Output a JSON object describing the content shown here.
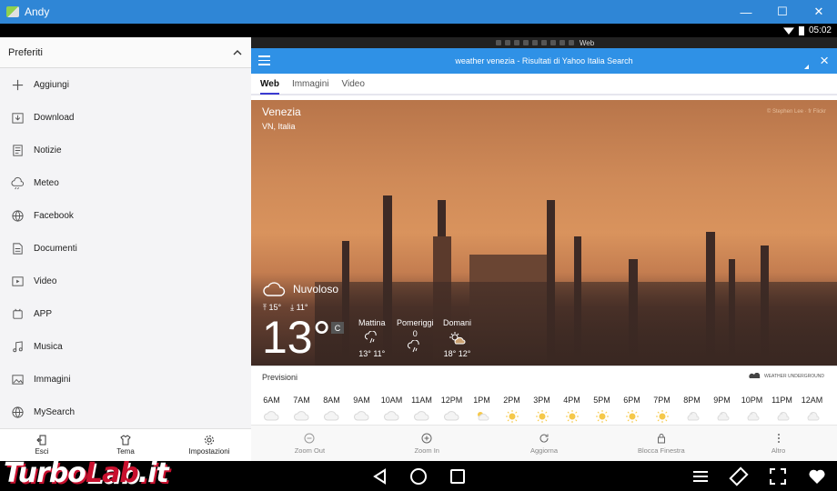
{
  "window": {
    "title": "Andy",
    "controls": [
      "—",
      "☐",
      "✕"
    ]
  },
  "status_bar": {
    "time": "05:02"
  },
  "sidebar": {
    "header": "Preferiti",
    "items": [
      {
        "label": "Aggiungi",
        "icon": "plus-icon"
      },
      {
        "label": "Download",
        "icon": "download-icon"
      },
      {
        "label": "Notizie",
        "icon": "news-icon"
      },
      {
        "label": "Meteo",
        "icon": "weather-icon"
      },
      {
        "label": "Facebook",
        "icon": "globe-icon"
      },
      {
        "label": "Documenti",
        "icon": "document-icon"
      },
      {
        "label": "Video",
        "icon": "video-icon"
      },
      {
        "label": "APP",
        "icon": "app-icon"
      },
      {
        "label": "Musica",
        "icon": "music-icon"
      },
      {
        "label": "Immagini",
        "icon": "image-icon"
      },
      {
        "label": "MySearch",
        "icon": "globe-icon"
      }
    ],
    "bottom": [
      {
        "label": "Esci",
        "icon": "exit-icon"
      },
      {
        "label": "Tema",
        "icon": "shirt-icon"
      },
      {
        "label": "Impostazioni",
        "icon": "gear-icon"
      }
    ]
  },
  "browser": {
    "favbar_label": "Web",
    "page_title": "weather venezia - Risultati di Yahoo Italia Search",
    "tabs": [
      {
        "label": "Web",
        "active": true
      },
      {
        "label": "Immagini",
        "active": false
      },
      {
        "label": "Video",
        "active": false
      }
    ],
    "weather": {
      "city": "Venezia",
      "region": "VN, Italia",
      "credit": "© Stephen Lee · fr Flickr",
      "condition": "Nuvoloso",
      "high": "15°",
      "low": "11°",
      "temperature": "13°",
      "unit": "C",
      "forecast": [
        {
          "label": "Mattina",
          "values": "13°  11°",
          "icon": "rain-icon"
        },
        {
          "label": "Pomeriggi",
          "values": "0",
          "icon": "rain-icon"
        },
        {
          "label": "Domani",
          "values": "18°  12°",
          "icon": "partly-sunny-icon"
        }
      ]
    },
    "previsioni": {
      "title": "Previsioni",
      "provider": "WEATHER UNDERGROUND",
      "hours": [
        "6AM",
        "7AM",
        "8AM",
        "9AM",
        "10AM",
        "11AM",
        "12PM",
        "1PM",
        "2PM",
        "3PM",
        "4PM",
        "5PM",
        "6PM",
        "7PM",
        "8PM",
        "9PM",
        "10PM",
        "11PM",
        "12AM"
      ],
      "hour_icons": [
        "cloud",
        "cloud",
        "cloud",
        "cloud",
        "cloud",
        "cloud",
        "cloud",
        "partly-sunny",
        "sun",
        "sun",
        "sun",
        "sun",
        "sun",
        "sun",
        "night-cloud",
        "night-cloud",
        "night-cloud",
        "night-cloud",
        "night-cloud"
      ]
    },
    "toolbar": [
      {
        "label": "Zoom Out",
        "icon": "zoom-out-icon"
      },
      {
        "label": "Zoom In",
        "icon": "zoom-in-icon"
      },
      {
        "label": "Aggiorna",
        "icon": "refresh-icon"
      },
      {
        "label": "Blocca Finestra",
        "icon": "lock-icon"
      },
      {
        "label": "Altro",
        "icon": "more-icon"
      }
    ]
  },
  "watermark": {
    "part1": "Turbo",
    "part2": "Lab",
    "part3": ".it"
  }
}
